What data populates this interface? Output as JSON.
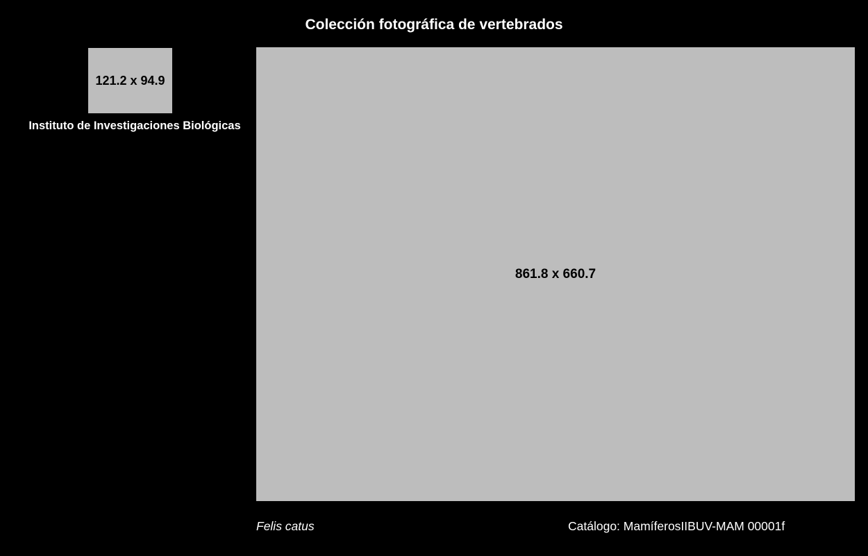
{
  "header": {
    "title": "Colección fotográfica de vertebrados"
  },
  "institution": {
    "logo_placeholder_text": "121.2 x 94.9",
    "name": "Instituto de Investigaciones Biológicas"
  },
  "photo": {
    "placeholder_text": "861.8 x 660.7"
  },
  "footer": {
    "species": "Felis catus",
    "catalog": "Catálogo: MamíferosIIBUV-MAM 00001f"
  },
  "colors": {
    "background": "#000000",
    "placeholder": "#bdbdbd",
    "text": "#ffffff"
  }
}
